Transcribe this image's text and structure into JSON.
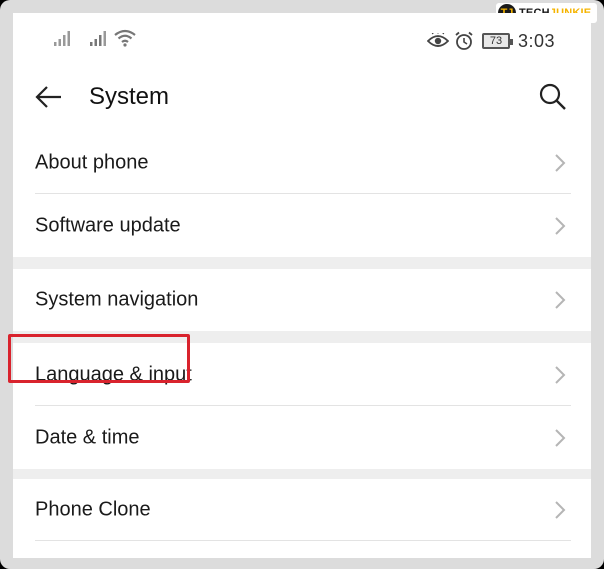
{
  "status_bar": {
    "time": "3:03",
    "battery_level": "73",
    "icons": [
      "signal-icon",
      "signal-icon",
      "wifi-icon",
      "eye-comfort-icon",
      "alarm-icon",
      "battery-icon"
    ]
  },
  "watermark": {
    "mark": "TJ",
    "text_prefix": "TECH",
    "text_suffix": "JUNKIE"
  },
  "header": {
    "title": "System",
    "back_icon": "arrow-left-icon",
    "search_icon": "search-icon"
  },
  "groups": [
    {
      "items": [
        {
          "label": "About phone"
        },
        {
          "label": "Software update"
        }
      ]
    },
    {
      "items": [
        {
          "label": "System navigation"
        }
      ]
    },
    {
      "items": [
        {
          "label": "Language & input",
          "highlighted": true
        },
        {
          "label": "Date & time"
        }
      ]
    },
    {
      "items": [
        {
          "label": "Phone Clone"
        }
      ]
    }
  ],
  "colors": {
    "highlight": "#d9232d",
    "separator": "#eeeeee",
    "text": "#1a1a1a",
    "chevron": "#b5b5b5"
  }
}
